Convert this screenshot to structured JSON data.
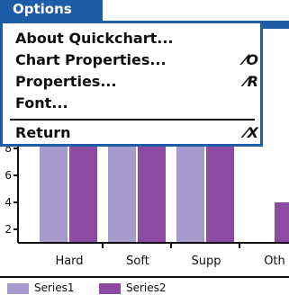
{
  "menu": {
    "tab_label": "Options",
    "items": [
      {
        "label": "About Quickchart...",
        "shortcut": ""
      },
      {
        "label": "Chart Properties...",
        "shortcut": "⁄O"
      },
      {
        "label": "Properties...",
        "shortcut": "⁄R"
      },
      {
        "label": "Font...",
        "shortcut": ""
      },
      {
        "label": "Return",
        "shortcut": "⁄X"
      }
    ]
  },
  "chart_data": {
    "type": "bar",
    "categories": [
      "Hard",
      "Soft",
      "Supp",
      "Oth"
    ],
    "series": [
      {
        "name": "Series1",
        "values": [
          11,
          12,
          14,
          0
        ],
        "color": "#a79acc"
      },
      {
        "name": "Series2",
        "values": [
          11,
          11,
          10,
          4
        ],
        "color": "#8d4aa2"
      }
    ],
    "y_ticks": [
      "2",
      "4",
      "6",
      "8"
    ],
    "ylim": [
      1,
      9
    ],
    "legend_position": "bottom"
  }
}
